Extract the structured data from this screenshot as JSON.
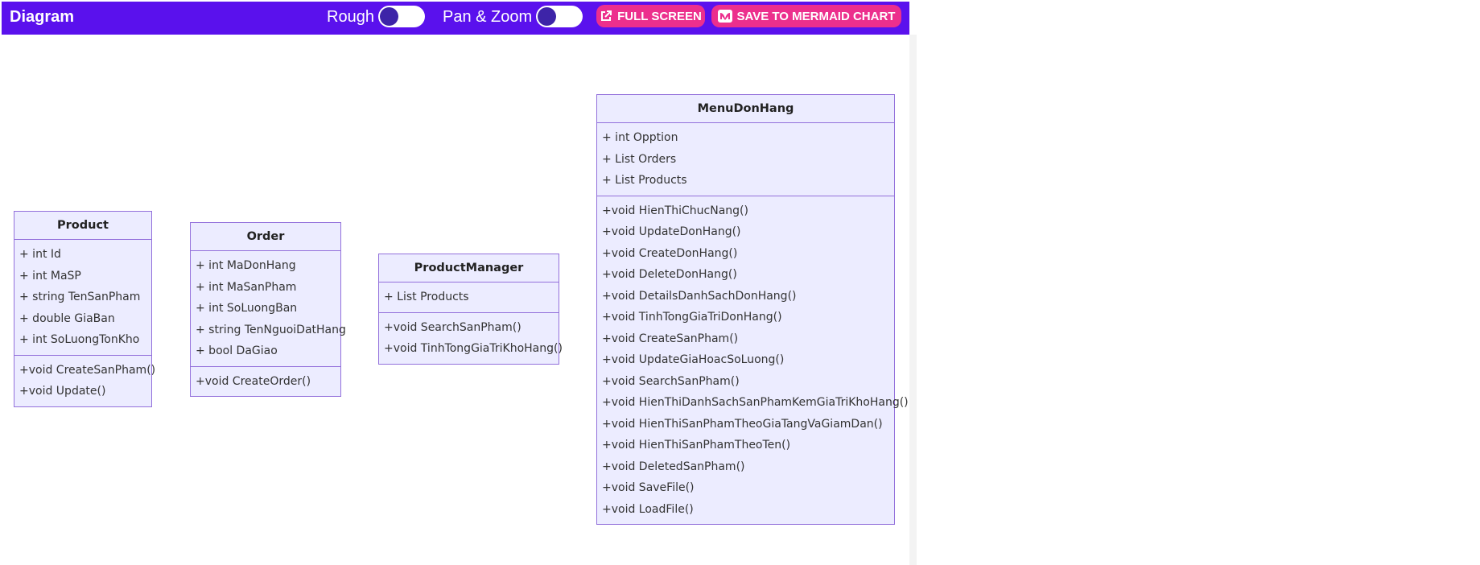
{
  "toolbar": {
    "title": "Diagram",
    "rough_label": "Rough",
    "panzoom_label": "Pan & Zoom",
    "fullscreen_label": "FULL SCREEN",
    "save_label": "SAVE TO MERMAID CHART",
    "rough_enabled": false,
    "panzoom_enabled": false
  },
  "colors": {
    "toolbar_bg": "#5a11ed",
    "button_bg": "#ec2f8d",
    "class_fill": "#ececff",
    "class_border": "#9370db"
  },
  "classes": [
    {
      "name": "Product",
      "attributes": [
        "+ int Id",
        "+ int MaSP",
        "+ string TenSanPham",
        "+ double GiaBan",
        "+ int SoLuongTonKho"
      ],
      "methods": [
        "+void CreateSanPham()",
        "+void Update()"
      ]
    },
    {
      "name": "Order",
      "attributes": [
        "+ int MaDonHang",
        "+ int MaSanPham",
        "+ int SoLuongBan",
        "+ string TenNguoiDatHang",
        "+ bool DaGiao"
      ],
      "methods": [
        "+void CreateOrder()"
      ]
    },
    {
      "name": "ProductManager",
      "attributes": [
        "+ List Products"
      ],
      "methods": [
        "+void SearchSanPham()",
        "+void TinhTongGiaTriKhoHang()"
      ]
    },
    {
      "name": "MenuDonHang",
      "attributes": [
        "+ int Opption",
        "+ List Orders",
        "+ List Products"
      ],
      "methods": [
        "+void HienThiChucNang()",
        "+void UpdateDonHang()",
        "+void CreateDonHang()",
        "+void DeleteDonHang()",
        "+void DetailsDanhSachDonHang()",
        "+void TinhTongGiaTriDonHang()",
        "+void CreateSanPham()",
        "+void UpdateGiaHoacSoLuong()",
        "+void SearchSanPham()",
        "+void HienThiDanhSachSanPhamKemGiaTriKhoHang()",
        "+void HienThiSanPhamTheoGiaTangVaGiamDan()",
        "+void HienThiSanPhamTheoTen()",
        "+void DeletedSanPham()",
        "+void SaveFile()",
        "+void LoadFile()"
      ]
    }
  ]
}
